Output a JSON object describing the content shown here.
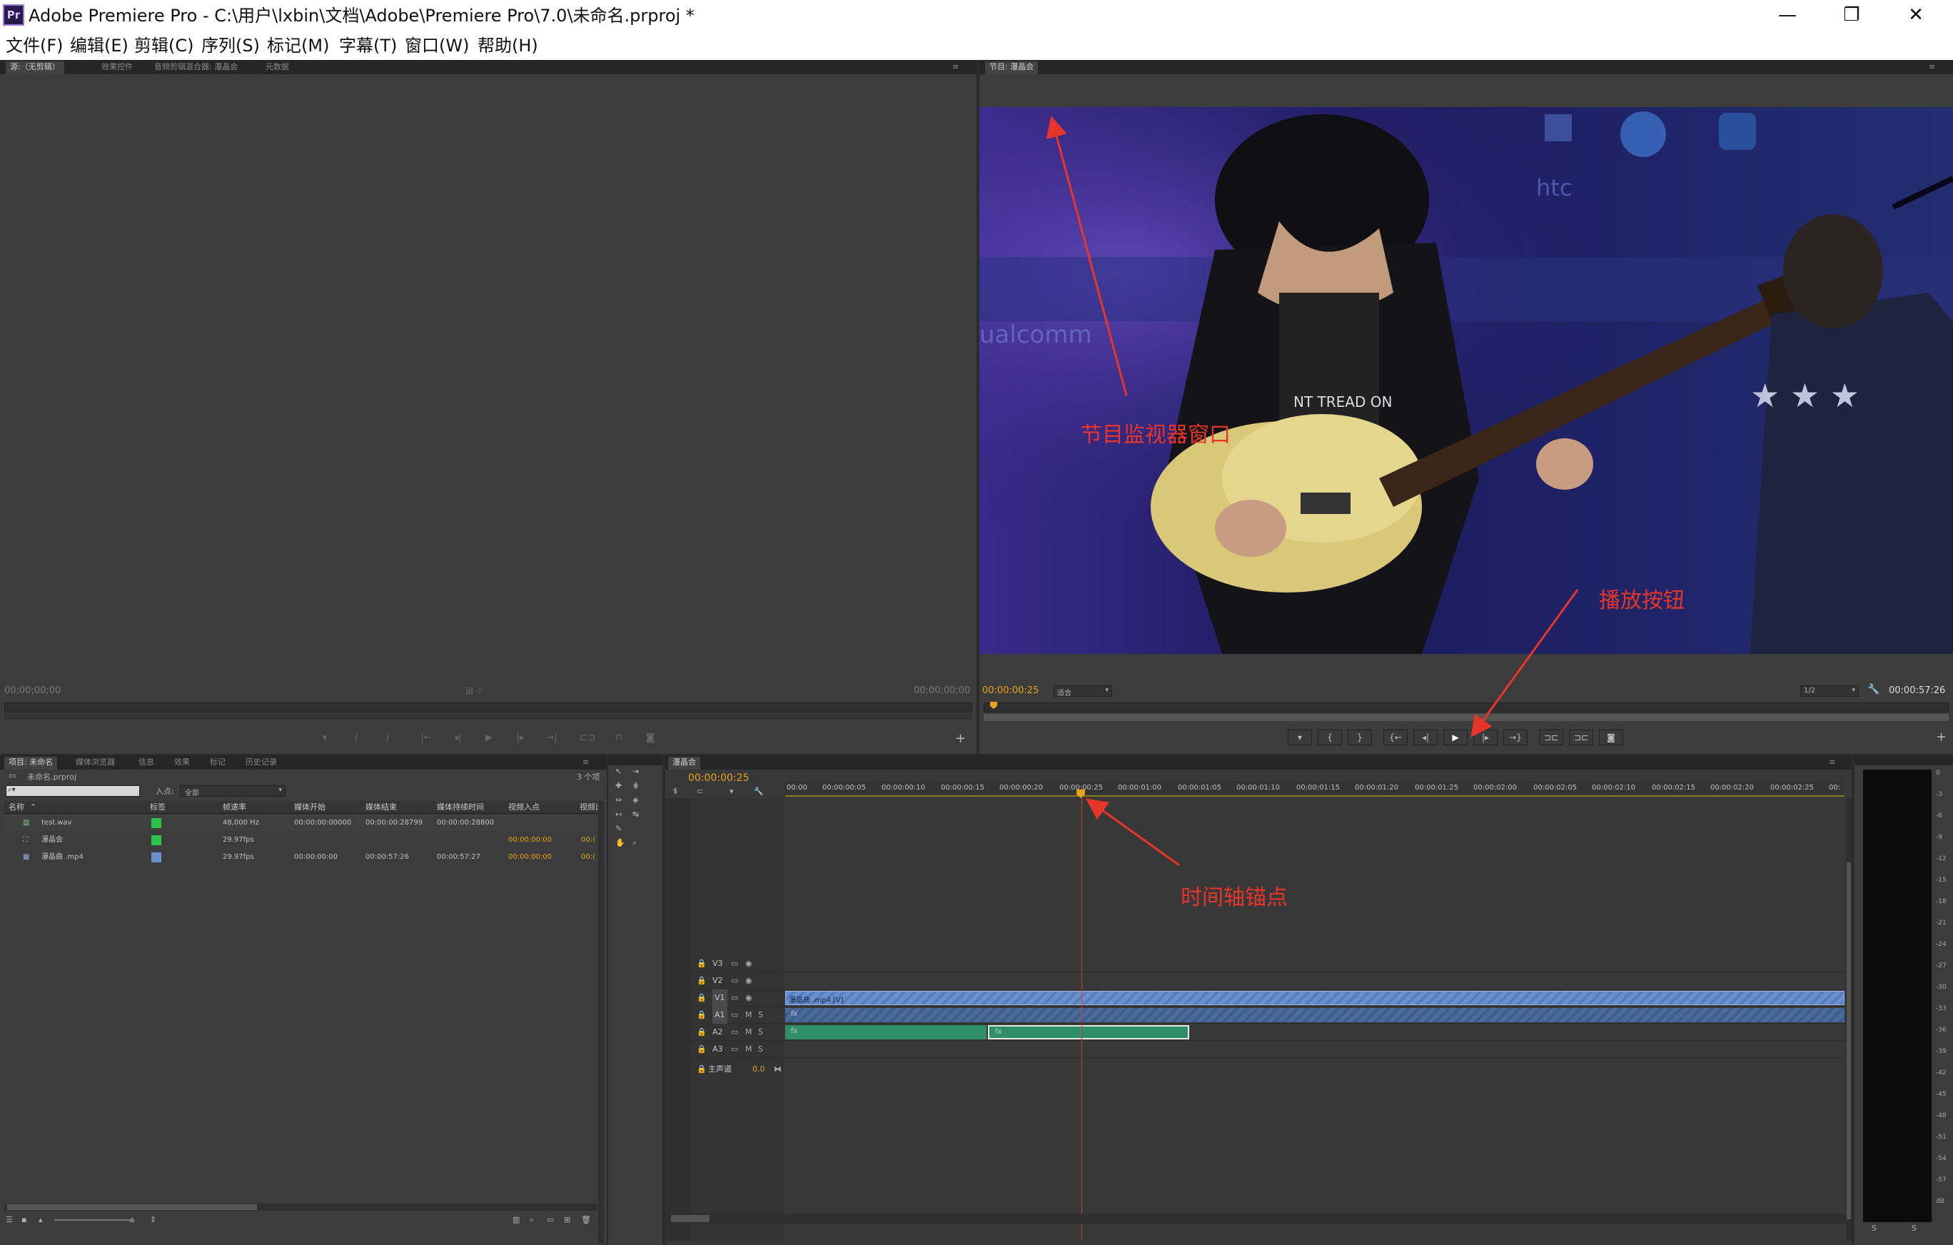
{
  "window": {
    "icon_label": "Pr",
    "title": "Adobe Premiere Pro - C:\\用户\\lxbin\\文档\\Adobe\\Premiere Pro\\7.0\\未命名.prproj *",
    "minimize": "—",
    "restore": "❐",
    "close": "✕"
  },
  "menu": [
    "文件(F)",
    "编辑(E)",
    "剪辑(C)",
    "序列(S)",
    "标记(M)",
    "字幕(T)",
    "窗口(W)",
    "帮助(H)"
  ],
  "source_panel": {
    "tabs": [
      "源:（无剪辑）",
      "效果控件",
      "音频剪辑混合器: 瀑晶会",
      "元数据"
    ],
    "tc_left": "00;00;00;00",
    "tc_right": "00;00;00;00"
  },
  "program_panel": {
    "tab": "节目: 瀑晶会",
    "tc_current": "00:00:00:25",
    "fit": "适合",
    "quality": "1/2",
    "tc_duration": "00:00:57:26"
  },
  "project_panel": {
    "tabs": [
      "项目: 未命名",
      "媒体浏览器",
      "信息",
      "效果",
      "标记",
      "历史记录"
    ],
    "project_file": "未命名.prproj",
    "item_count": "3 个项",
    "search_placeholder": "",
    "in_label": "入点:",
    "in_value": "全部",
    "columns": [
      "名称",
      "标签",
      "帧速率",
      "媒体开始",
      "媒体结束",
      "媒体持续时间",
      "视频入点",
      "视频出"
    ],
    "rows": [
      {
        "name": "test.wav",
        "label_color": "#2ec24a",
        "rate": "48,000 Hz",
        "start": "00:00:00:00000",
        "end": "00:00:00:28799",
        "duration": "00:00:00:28800",
        "vin": "",
        "vout": ""
      },
      {
        "name": "瀑晶会",
        "label_color": "#2ec24a",
        "rate": "29.97fps",
        "start": "",
        "end": "",
        "duration": "",
        "vin": "00:00:00:00",
        "vout": "00:("
      },
      {
        "name": "瀑晶曲 .mp4",
        "label_color": "#6c8fd0",
        "rate": "29.97fps",
        "start": "00:00:00:00",
        "end": "00:00:57:26",
        "duration": "00:00:57:27",
        "vin": "00:00:00:00",
        "vout": "00:("
      }
    ]
  },
  "timeline": {
    "tab": "瀑晶会",
    "tc": "00:00:00:25",
    "ruler": [
      "00:00",
      "00:00:00:05",
      "00:00:00:10",
      "00:00:00:15",
      "00:00:00:20",
      "00:00:00:25",
      "00:00:01:00",
      "00:00:01:05",
      "00:00:01:10",
      "00:00:01:15",
      "00:00:01:20",
      "00:00:01:25",
      "00:00:02:00",
      "00:00:02:05",
      "00:00:02:10",
      "00:00:02:15",
      "00:00:02:20",
      "00:00:02:25",
      "00:"
    ],
    "tracks": [
      "V3",
      "V2",
      "V1",
      "A1",
      "A2",
      "A3"
    ],
    "master": "主声道",
    "master_value": "0.0",
    "video_clip_label": "瀑晶曲 .mp4 [V]",
    "audio_clip_label": "fx"
  },
  "meter": {
    "labels": [
      "0",
      "-3",
      "-6",
      "-9",
      "-12",
      "-15",
      "-18",
      "-21",
      "-24",
      "-27",
      "-30",
      "-33",
      "-36",
      "-39",
      "-42",
      "-45",
      "-48",
      "-51",
      "-54",
      "-57",
      "dB"
    ]
  },
  "annotations": {
    "program_monitor": "节目监视器窗口",
    "play_button": "播放按钮",
    "timeline_anchor": "时间轴锚点"
  },
  "colors": {
    "accent_timecode": "#e8a417",
    "annotation": "#e8352a",
    "video_clip": "#6a8fcf",
    "audio_clip": "#2f8f6a"
  }
}
